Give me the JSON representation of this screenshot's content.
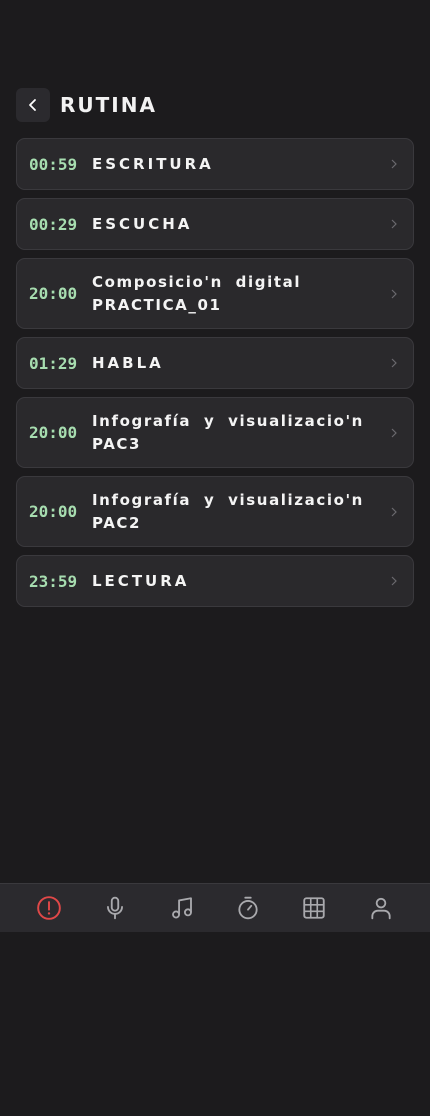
{
  "header": {
    "title": "RUTINA"
  },
  "tasks": [
    {
      "time": "00:59",
      "label": "ESCRITURA"
    },
    {
      "time": "00:29",
      "label": "ESCUCHA"
    },
    {
      "time": "20:00",
      "label": "Composicio'n digital PRACTICA_01"
    },
    {
      "time": "01:29",
      "label": "HABLA"
    },
    {
      "time": "20:00",
      "label": "Infografía y visualizacio'n PAC3"
    },
    {
      "time": "20:00",
      "label": "Infografía y visualizacio'n PAC2"
    },
    {
      "time": "23:59",
      "label": "LECTURA"
    }
  ],
  "nav": {
    "items": [
      "alert-icon",
      "microphone-icon",
      "music-icon",
      "timer-icon",
      "grid-icon",
      "user-icon"
    ],
    "active_color": "#e04848",
    "inactive_color": "#a9a9ad"
  },
  "colors": {
    "background": "#1c1b1d",
    "card": "#2a292c",
    "time": "#a7ddb0"
  }
}
